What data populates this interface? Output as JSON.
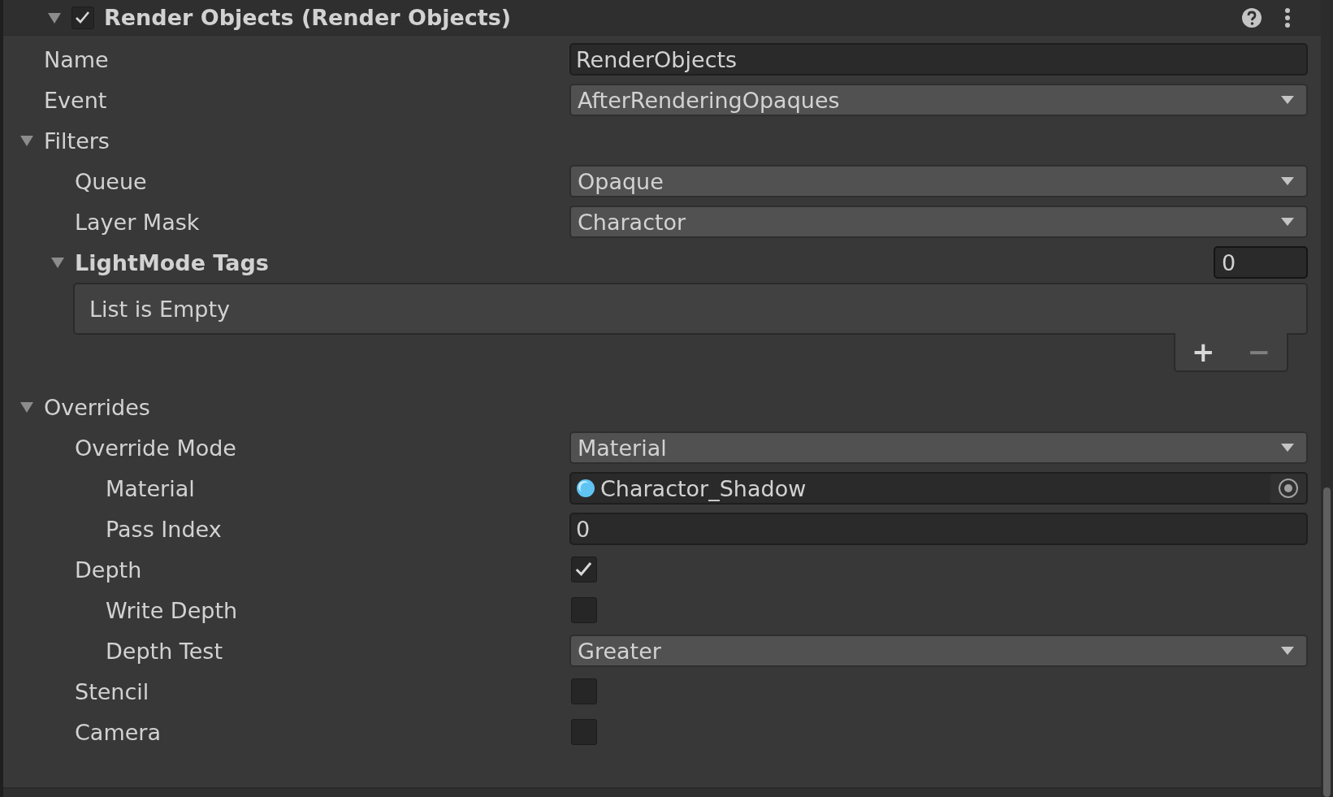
{
  "header": {
    "title": "Render Objects (Render Objects)",
    "expanded": true,
    "enabled": true
  },
  "properties": [
    {
      "kind": "text",
      "label": "Name",
      "value": "RenderObjects"
    },
    {
      "kind": "dropdown",
      "label": "Event",
      "value": "AfterRenderingOpaques"
    },
    {
      "kind": "foldout",
      "label": "Filters",
      "expanded": true,
      "children": [
        {
          "kind": "dropdown",
          "label": "Queue",
          "value": "Opaque"
        },
        {
          "kind": "dropdown",
          "label": "Layer Mask",
          "value": "Charactor"
        },
        {
          "kind": "list",
          "label": "LightMode Tags",
          "expanded": true,
          "count": "0",
          "empty_text": "List is Empty",
          "buttons": [
            {
              "label": "+",
              "disabled": false
            },
            {
              "label": "−",
              "disabled": true
            }
          ]
        }
      ]
    },
    {
      "kind": "foldout",
      "label": "Overrides",
      "expanded": true,
      "children": [
        {
          "kind": "dropdown",
          "label": "Override Mode",
          "value": "Material",
          "children": [
            {
              "kind": "object",
              "label": "Material",
              "value": "Charactor_Shadow"
            },
            {
              "kind": "text",
              "label": "Pass Index",
              "value": "0"
            }
          ]
        },
        {
          "kind": "checkbox",
          "label": "Depth",
          "checked": true,
          "children": [
            {
              "kind": "checkbox",
              "label": "Write Depth",
              "checked": false
            },
            {
              "kind": "dropdown",
              "label": "Depth Test",
              "value": "Greater"
            }
          ]
        },
        {
          "kind": "checkbox",
          "label": "Stencil",
          "checked": false
        },
        {
          "kind": "checkbox",
          "label": "Camera",
          "checked": false
        }
      ]
    }
  ]
}
